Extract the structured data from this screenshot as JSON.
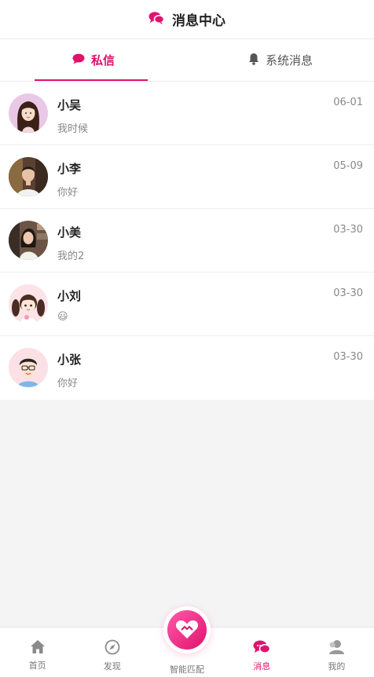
{
  "header": {
    "title": "消息中心",
    "icon": "chat-bubbles-icon"
  },
  "tabs": [
    {
      "label": "私信",
      "icon": "chat-bubble-icon",
      "active": true
    },
    {
      "label": "系统消息",
      "icon": "bell-icon",
      "active": false
    }
  ],
  "messages": [
    {
      "name": "小吴",
      "preview": "我时候",
      "time": "06-01",
      "avatar": "woman-long-hair-avatar"
    },
    {
      "name": "小李",
      "preview": "你好",
      "time": "05-09",
      "avatar": "man-photo-avatar"
    },
    {
      "name": "小美",
      "preview": "我的2",
      "time": "03-30",
      "avatar": "woman-photo-avatar"
    },
    {
      "name": "小刘",
      "preview": "😃",
      "time": "03-30",
      "avatar": "girl-pigtails-avatar"
    },
    {
      "name": "小张",
      "preview": "你好",
      "time": "03-30",
      "avatar": "man-glasses-avatar"
    }
  ],
  "tabbar": [
    {
      "label": "首页",
      "icon": "home-icon"
    },
    {
      "label": "发现",
      "icon": "compass-icon"
    },
    {
      "label": "智能匹配",
      "icon": "heart-handshake-icon"
    },
    {
      "label": "消息",
      "icon": "chat-bubbles-icon",
      "active": true
    },
    {
      "label": "我的",
      "icon": "user-icon"
    }
  ],
  "colors": {
    "accent": "#e0126d",
    "muted": "#888888",
    "background": "#f4f4f5"
  }
}
